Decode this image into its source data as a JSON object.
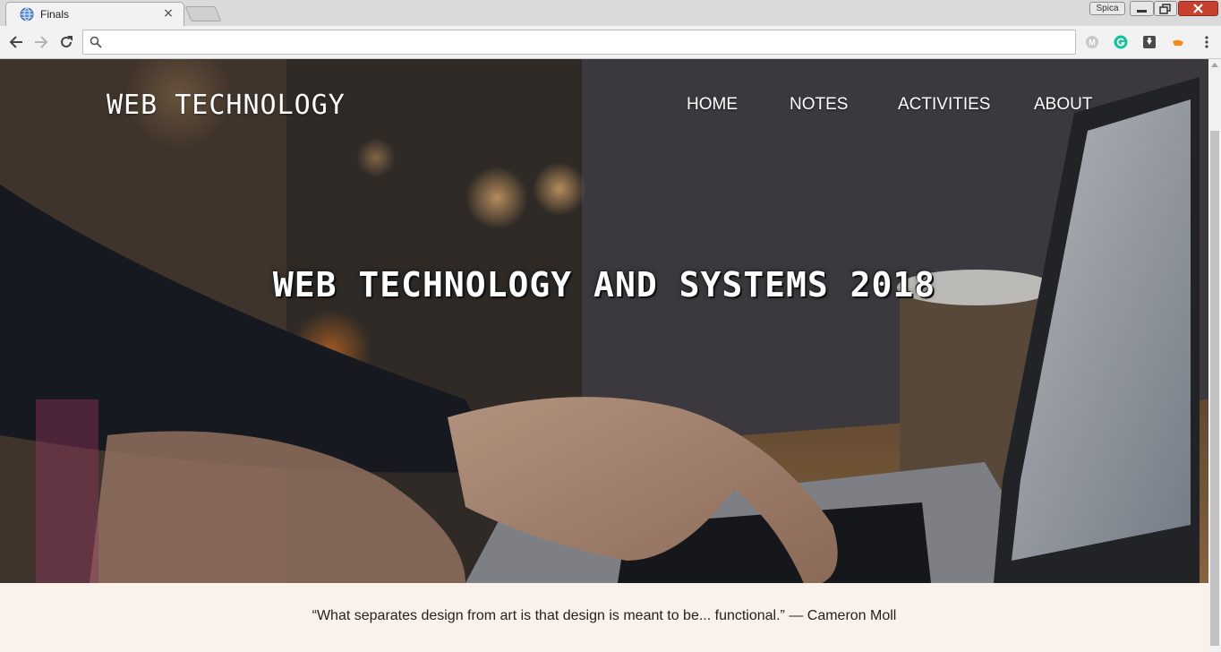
{
  "browser": {
    "tab_title": "Finals",
    "tab_icon": "globe-icon",
    "profile_name": "Spica",
    "address_value": "",
    "colors": {
      "close_button": "#c7412f",
      "toolbar": "#f2f2f2"
    }
  },
  "site": {
    "brand": "WEB TECHNOLOGY",
    "nav": [
      {
        "label": "HOME"
      },
      {
        "label": "NOTES"
      },
      {
        "label": "ACTIVITIES"
      },
      {
        "label": "ABOUT"
      }
    ],
    "headline": "WEB TECHNOLOGY AND SYSTEMS 2018",
    "quote": "“What separates design from art is that design is meant to be... functional.” — Cameron Moll",
    "colors": {
      "quote_background": "#faf1ea",
      "text_on_hero": "#ffffff"
    }
  }
}
